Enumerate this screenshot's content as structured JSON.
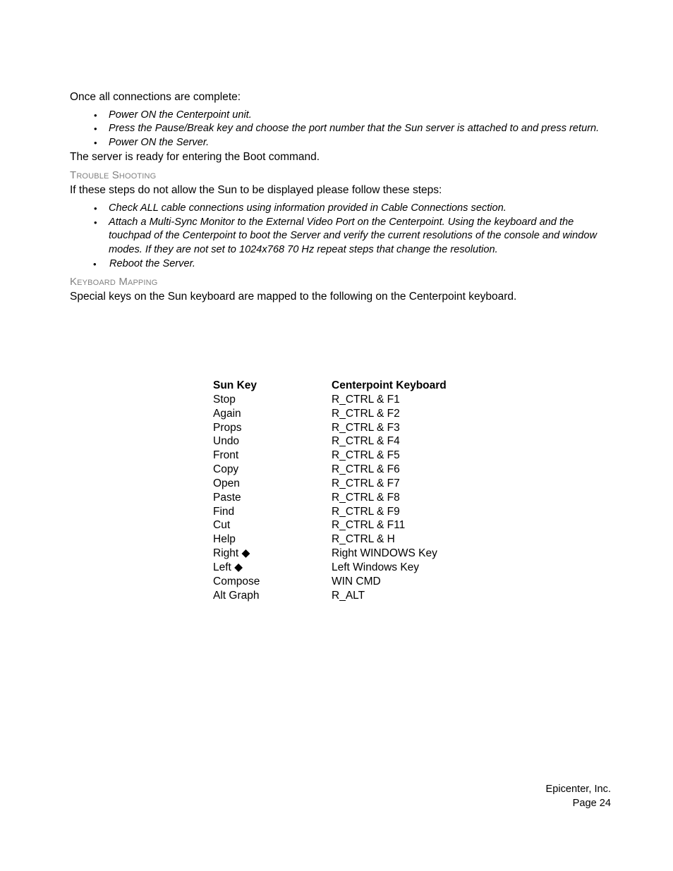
{
  "document": {
    "intro_line": "Once all connections are complete:",
    "after_list_line": "The server is ready for entering the Boot command.",
    "setup_steps": [
      "Power ON the Centerpoint unit.",
      "Press the Pause/Break key and choose the port number that the Sun server is attached to and press return.",
      "Power ON the Server."
    ],
    "troubleshooting": {
      "heading": "Trouble Shooting",
      "intro": "If these steps do not allow the Sun to be displayed please follow these steps:",
      "steps": [
        "Check ALL cable connections using information provided in Cable Connections section.",
        "Attach a Multi-Sync Monitor to the External Video Port on the Centerpoint.  Using the keyboard and the touchpad of the Centerpoint to boot the Server and verify the current resolutions of the console and window modes.  If they are not set to 1024x768 70 Hz repeat steps that change the resolution.",
        "Reboot the Server."
      ]
    },
    "keyboard_mapping": {
      "heading": "Keyboard Mapping",
      "intro": "Special keys on the Sun keyboard are mapped to the following on the Centerpoint keyboard.",
      "columns": [
        "Sun Key",
        "Centerpoint Keyboard"
      ],
      "rows": [
        {
          "sun_key": "Stop",
          "centerpoint": "R_CTRL & F1"
        },
        {
          "sun_key": "Again",
          "centerpoint": "R_CTRL & F2"
        },
        {
          "sun_key": "Props",
          "centerpoint": "R_CTRL & F3"
        },
        {
          "sun_key": "Undo",
          "centerpoint": "R_CTRL & F4"
        },
        {
          "sun_key": "Front",
          "centerpoint": "R_CTRL & F5"
        },
        {
          "sun_key": "Copy",
          "centerpoint": "R_CTRL & F6"
        },
        {
          "sun_key": "Open",
          "centerpoint": "R_CTRL & F7"
        },
        {
          "sun_key": "Paste",
          "centerpoint": "R_CTRL & F8"
        },
        {
          "sun_key": "Find",
          "centerpoint": "R_CTRL & F9"
        },
        {
          "sun_key": "Cut",
          "centerpoint": "R_CTRL & F11"
        },
        {
          "sun_key": "Help",
          "centerpoint": "R_CTRL & H"
        },
        {
          "sun_key": "Right ◆",
          "centerpoint": "Right WINDOWS Key"
        },
        {
          "sun_key": "Left ◆",
          "centerpoint": "Left Windows Key"
        },
        {
          "sun_key": "Compose",
          "centerpoint": "WIN CMD"
        },
        {
          "sun_key": "Alt Graph",
          "centerpoint": "R_ALT"
        }
      ]
    },
    "footer": {
      "company": "Epicenter, Inc.",
      "page": "Page 24"
    },
    "bullet_glyph": "•",
    "colors": {
      "heading": "#808080",
      "body_text": "#000000",
      "page_background": "#ffffff"
    }
  }
}
